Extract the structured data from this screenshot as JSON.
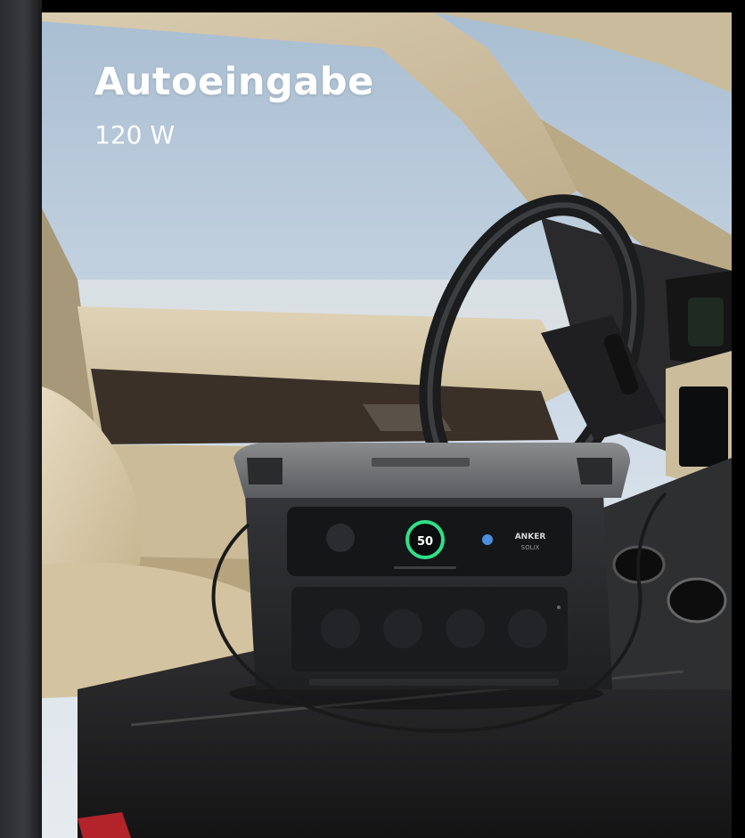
{
  "card": {
    "title": "Autoeingabe",
    "subtitle": "120 W"
  },
  "device": {
    "display_value": "50",
    "brand_label": "ANKER",
    "brand_sub": "SOLIX"
  },
  "colors": {
    "sky": "#c9d6e3",
    "interior_beige": "#d8c9a8",
    "dash_dark": "#232325",
    "device_body": "#2c2d30",
    "device_top": "#6e6f71",
    "display_ring": "#2fe08a",
    "text": "#ffffff"
  }
}
